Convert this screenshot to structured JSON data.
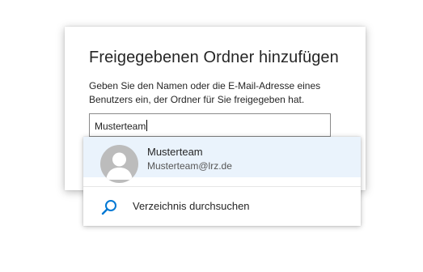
{
  "dialog": {
    "title": "Freigegebenen Ordner hinzufügen",
    "description": "Geben Sie den Namen oder die E-Mail-Adresse eines Benutzers ein, der Ordner für Sie freigegeben hat.",
    "input_value": "Musterteam"
  },
  "dropdown": {
    "suggestion": {
      "name": "Musterteam",
      "email": "Musterteam@lrz.de",
      "avatar_icon": "person-avatar-icon"
    },
    "directory_search": {
      "label": "Verzeichnis durchsuchen",
      "icon": "search-icon"
    }
  },
  "colors": {
    "accent": "#0078d4",
    "suggestion_highlight": "#eaf3fc",
    "avatar_bg": "#bcbcbc"
  }
}
